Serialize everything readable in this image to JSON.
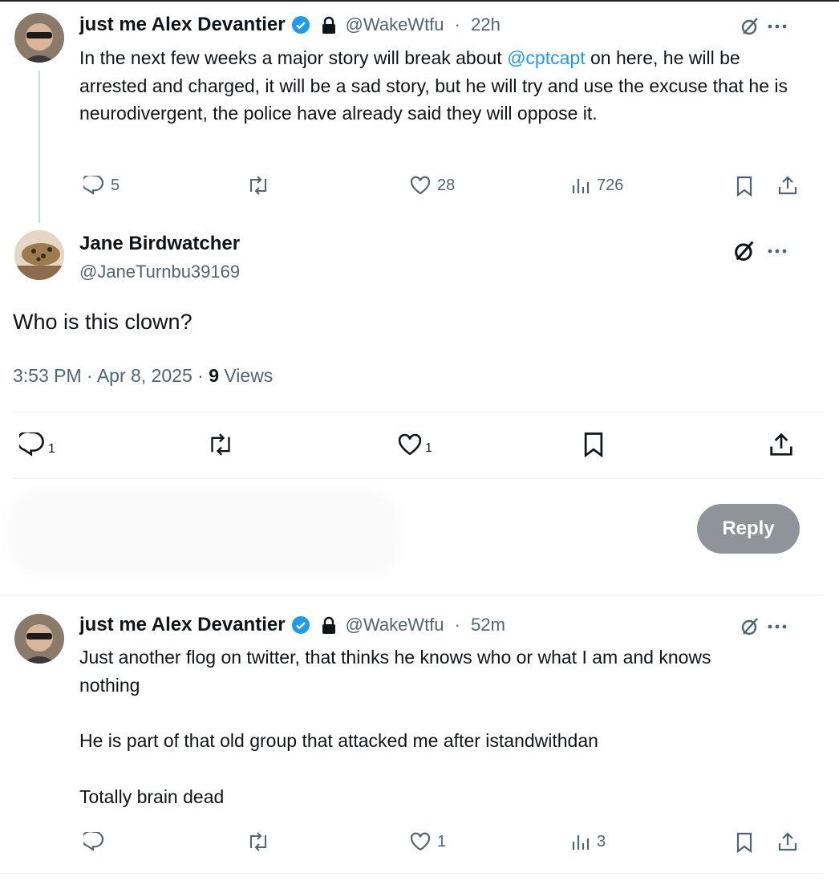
{
  "tweet1": {
    "name": "just me Alex Devantier",
    "handle": "@WakeWtfu",
    "time": "22h",
    "text_before": "In the next few weeks a major story will break about ",
    "mention": "@cptcapt",
    "text_after": " on here, he will be arrested and charged, it will be a sad story, but he will try and use the excuse that he is neurodivergent, the police have already said they will oppose it.",
    "replies": "5",
    "likes": "28",
    "views": "726"
  },
  "tweet2": {
    "name": "Jane Birdwatcher",
    "handle": "@JaneTurnbu39169",
    "text": "Who is this clown?",
    "timestamp": "3:53 PM · Apr 8, 2025 · ",
    "views_count": "9",
    "views_label": " Views",
    "replies": "1",
    "likes": "1"
  },
  "reply_composer": {
    "button_label": "Reply"
  },
  "tweet3": {
    "name": "just me Alex Devantier",
    "handle": "@WakeWtfu",
    "time": "52m",
    "line1": "Just another flog on twitter, that thinks he knows who or what I am and knows nothing",
    "line2": "He is part of that old group that attacked me after istandwithdan",
    "line3": "Totally brain dead",
    "likes": "1",
    "views": "3"
  },
  "separator": " · ",
  "icons": {
    "verified": "verified-badge-icon",
    "lock": "lock-icon",
    "grok": "grok-icon",
    "more": "more-icon",
    "reply": "reply-icon",
    "retweet": "retweet-icon",
    "like": "like-icon",
    "views": "views-icon",
    "bookmark": "bookmark-icon",
    "share": "share-icon"
  },
  "colors": {
    "link": "#1d9bf0",
    "verified": "#1d9bf0",
    "reply_button": "#8e9499",
    "muted": "#536471"
  }
}
